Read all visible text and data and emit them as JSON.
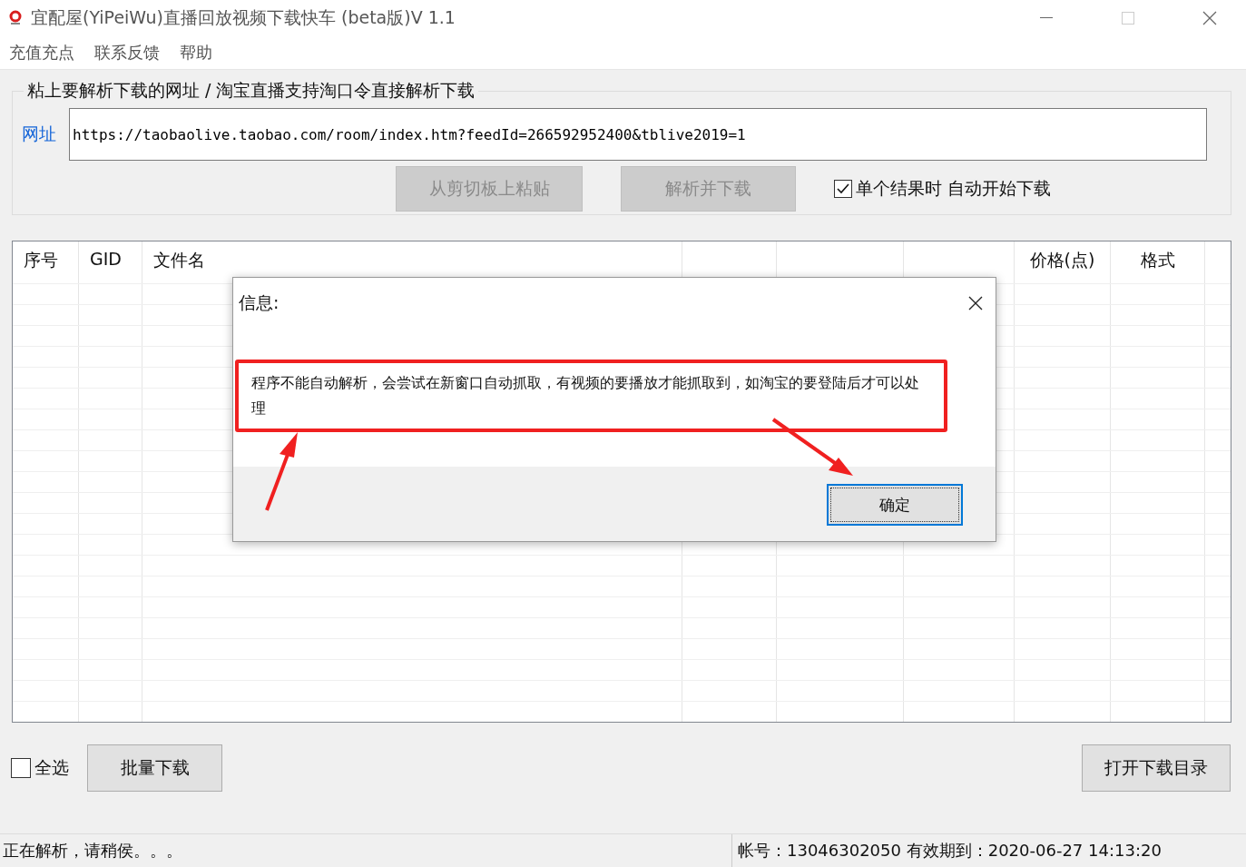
{
  "window": {
    "title": "宜配屋(YiPeiWu)直播回放视频下载快车 (beta版)V 1.1"
  },
  "menu": [
    "充值充点",
    "联系反馈",
    "帮助"
  ],
  "url_group": {
    "title": "粘上要解析下载的网址 / 淘宝直播支持淘口令直接解析下载",
    "label": "网址",
    "value": "https://taobaolive.taobao.com/room/index.htm?feedId=266592952400&tblive2019=1",
    "buttons": [
      {
        "label": "从剪切板上粘贴",
        "disabled": true
      },
      {
        "label": "解析并下载",
        "disabled": true
      }
    ],
    "auto_download": {
      "label": "单个结果时 自动开始下载",
      "checked": true
    }
  },
  "table": {
    "columns": [
      {
        "kind": "text",
        "label": "序号"
      },
      {
        "kind": "text",
        "label": "GID"
      },
      {
        "kind": "text",
        "label": "文件名"
      },
      {
        "kind": "covered"
      },
      {
        "kind": "covered"
      },
      {
        "kind": "covered"
      },
      {
        "kind": "text",
        "label": "价格(点)"
      },
      {
        "kind": "text",
        "label": "格式"
      }
    ]
  },
  "select_all": {
    "label": "全选",
    "checked": false
  },
  "batch_button": "批量下载",
  "open_dir_button": "打开下载目录",
  "status_bar": {
    "left": "正在解析，请稍侯。。。",
    "right": "帐号：13046302050 有效期到：2020-06-27 14:13:20"
  },
  "dialog": {
    "title": "信息:",
    "message": "程序不能自动解析，会尝试在新窗口自动抓取，有视频的要播放才能抓取到，如淘宝的要登陆后才可以处理",
    "ok": "确定"
  }
}
